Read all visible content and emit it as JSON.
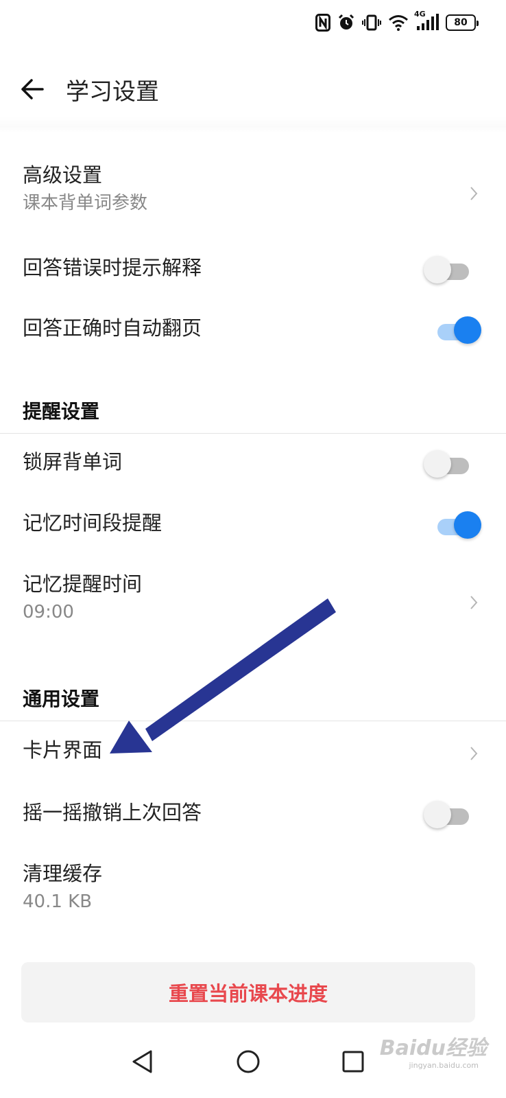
{
  "status_bar": {
    "network_label": "4G",
    "battery_level": "80"
  },
  "header": {
    "title": "学习设置"
  },
  "settings": {
    "advanced": {
      "title": "高级设置",
      "subtitle": "课本背单词参数"
    },
    "hint_on_wrong": {
      "label": "回答错误时提示解释",
      "enabled": false
    },
    "auto_flip_on_correct": {
      "label": "回答正确时自动翻页",
      "enabled": true
    }
  },
  "reminder_section": {
    "header": "提醒设置",
    "lockscreen": {
      "label": "锁屏背单词",
      "enabled": false
    },
    "memory_period_reminder": {
      "label": "记忆时间段提醒",
      "enabled": true
    },
    "reminder_time": {
      "title": "记忆提醒时间",
      "value": "09:00"
    }
  },
  "general_section": {
    "header": "通用设置",
    "card_interface": {
      "title": "卡片界面"
    },
    "shake_undo": {
      "label": "摇一摇撤销上次回答",
      "enabled": false
    },
    "clear_cache": {
      "title": "清理缓存",
      "value": "40.1 KB"
    }
  },
  "reset_button": {
    "label": "重置当前课本进度"
  },
  "watermark": {
    "text": "Baidu经验",
    "sub": "jingyan.baidu.com"
  },
  "colors": {
    "accent": "#1a80f0",
    "danger": "#e8484d",
    "annotation_arrow": "#283593"
  }
}
